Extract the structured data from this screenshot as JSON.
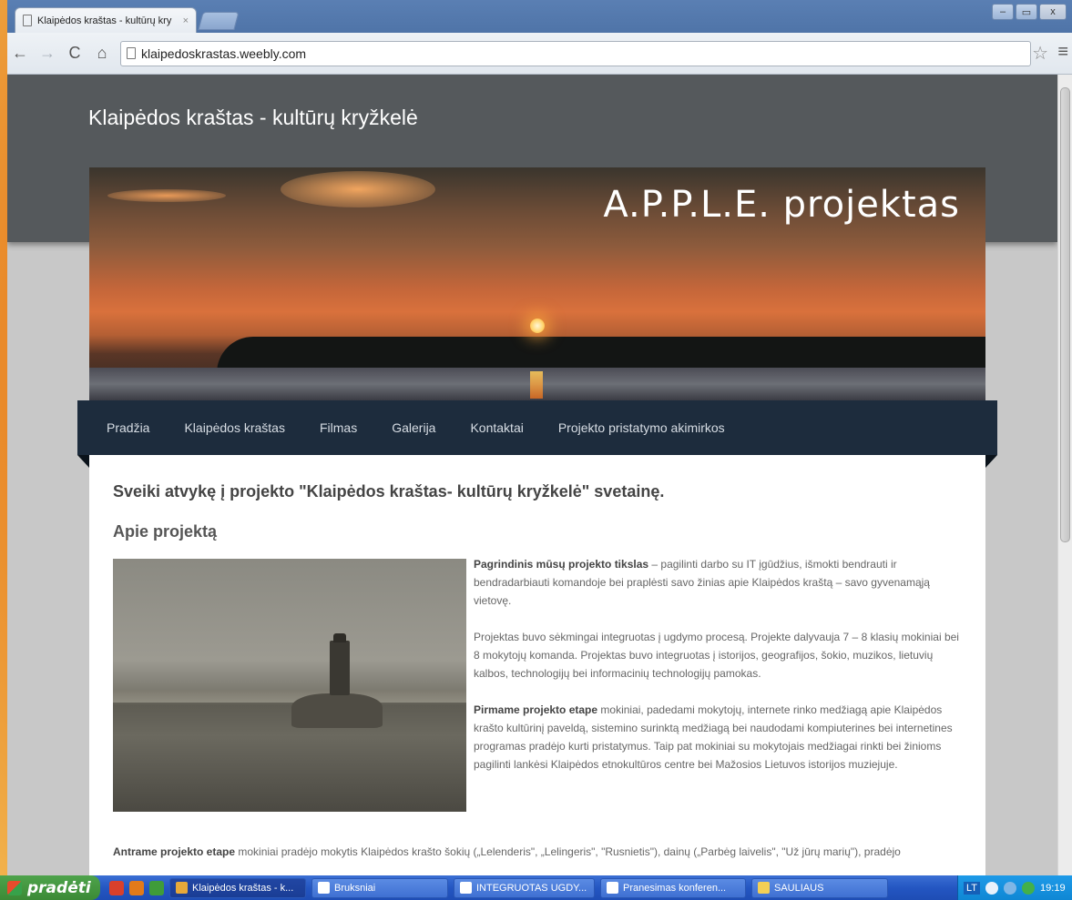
{
  "browser": {
    "tab_title": "Klaipėdos kraštas - kultūrų kry",
    "tab_close": "×",
    "url": "klaipedoskrastas.weebly.com",
    "window_controls": [
      "–",
      "▭",
      "x"
    ]
  },
  "site": {
    "title": "Klaipėdos kraštas - kultūrų kryžkelė",
    "banner_title": "A.P.P.L.E. projektas",
    "nav": [
      "Pradžia",
      "Klaipėdos kraštas",
      "Filmas",
      "Galerija",
      "Kontaktai",
      "Projekto pristatymo akimirkos"
    ],
    "welcome": "Sveiki atvykę į projekto \"Klaipėdos kraštas- kultūrų kryžkelė\" svetainę.",
    "about_heading": "Apie projektą",
    "para1_bold": "Pagrindinis mūsų projekto tikslas",
    "para1": " – pagilinti darbo su IT įgūdžius, išmokti bendrauti ir bendradarbiauti komandoje bei praplėsti savo žinias apie Klaipėdos kraštą – savo gyvenamąją vietovę.",
    "para2": "Projektas buvo sėkmingai integruotas į ugdymo procesą. Projekte dalyvauja 7 – 8 klasių mokiniai bei 8 mokytojų komanda. Projektas buvo integruotas į istorijos, geografijos, šokio, muzikos, lietuvių kalbos, technologijų bei informacinių technologijų pamokas.",
    "para3_bold": "Pirmame projekto etape",
    "para3": " mokiniai, padedami mokytojų, internete rinko medžiagą apie Klaipėdos krašto kultūrinį paveldą, sistemino surinktą medžiagą bei naudodami kompiuterines bei internetines programas pradėjo kurti pristatymus. Taip pat mokiniai su mokytojais medžiagai rinkti bei žinioms pagilinti lankėsi Klaipėdos etnokultūros centre bei Mažosios Lietuvos istorijos muziejuje.",
    "para4_bold": "Antrame projekto etape",
    "para4": " mokiniai pradėjo mokytis Klaipėdos krašto šokių („Lelenderis\", „Lelingeris\", \"Rusnietis\"), dainų („Parbėg laivelis\", \"Už jūrų marių\"), pradėjo"
  },
  "taskbar": {
    "start_label": "pradėti",
    "tasks": [
      "Klaipėdos kraštas - k...",
      "Bruksniai",
      "INTEGRUOTAS UGDY...",
      "Pranesimas konferen...",
      "SAULIAUS"
    ],
    "lang": "LT",
    "clock": "19:19"
  },
  "colors": {
    "header_band": "#55595c",
    "nav_bg": "#1d2c3d",
    "taskbar": "#2456c2",
    "start_button": "#3b8a36"
  }
}
